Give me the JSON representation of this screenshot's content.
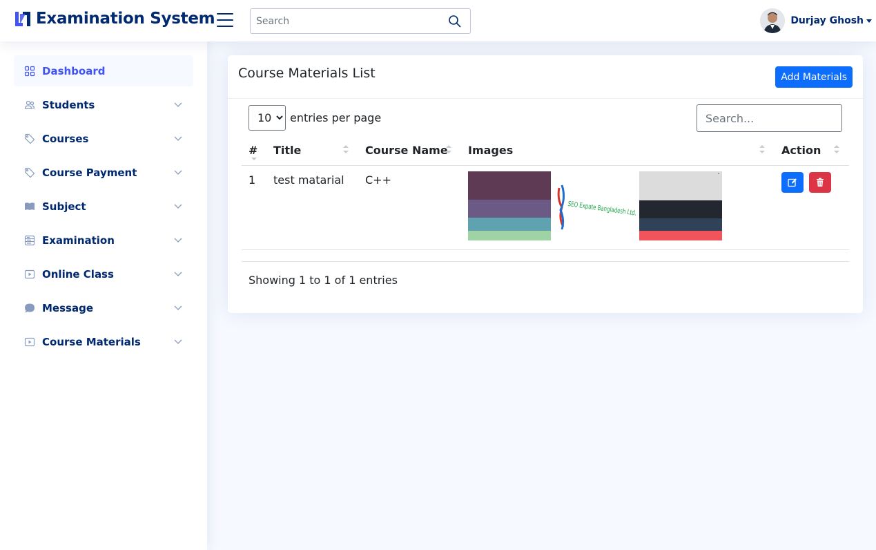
{
  "header": {
    "app_title": "Examination System",
    "search_placeholder": "Search",
    "user_name": "Durjay Ghosh"
  },
  "sidebar": {
    "items": [
      {
        "label": "Dashboard",
        "icon": "grid-icon",
        "active": true
      },
      {
        "label": "Students",
        "icon": "people-icon"
      },
      {
        "label": "Courses",
        "icon": "tag-icon"
      },
      {
        "label": "Course Payment",
        "icon": "tag-icon"
      },
      {
        "label": "Subject",
        "icon": "book-icon"
      },
      {
        "label": "Examination",
        "icon": "list-icon"
      },
      {
        "label": "Online Class",
        "icon": "play-icon"
      },
      {
        "label": "Message",
        "icon": "chat-icon"
      },
      {
        "label": "Course Materials",
        "icon": "play-icon"
      }
    ]
  },
  "card": {
    "title": "Course Materials List",
    "add_button": "Add Materials",
    "entries_value": "10",
    "entries_label": "entries per page",
    "search_placeholder": "Search...",
    "columns": [
      "#",
      "Title",
      "Course Name",
      "Images",
      "Action"
    ],
    "rows": [
      {
        "index": "1",
        "title": "test matarial",
        "course_name": "C++"
      }
    ],
    "image_watermark": "SEO Expate Bangladesh Ltd.",
    "showing": "Showing 1 to 1 of 1 entries"
  },
  "colors": {
    "brand": "#012970",
    "accent": "#4154f1",
    "primary": "#0d6efd",
    "danger": "#dc3545"
  }
}
